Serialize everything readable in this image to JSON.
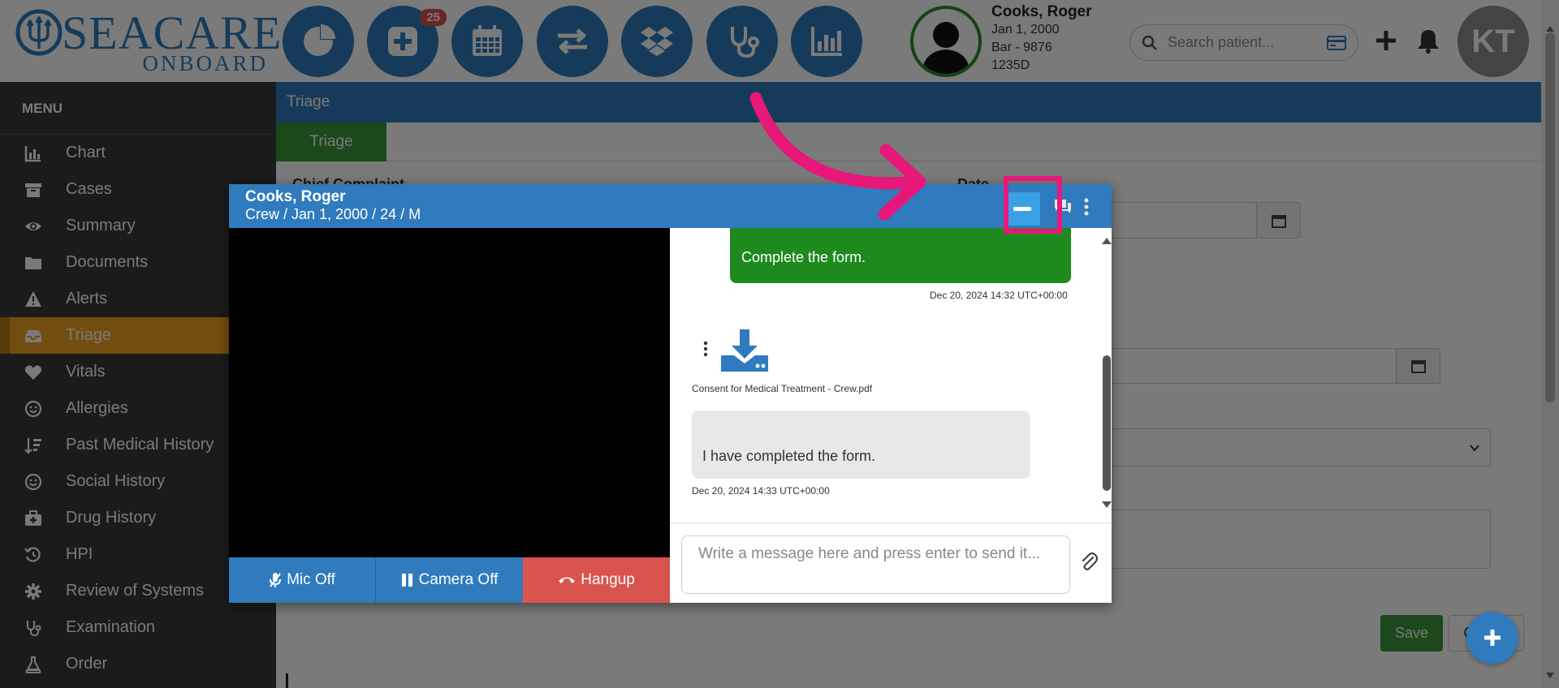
{
  "brand": {
    "name": "SEACARE",
    "tagline": "ONBOARD"
  },
  "nav": {
    "badge_count": "25",
    "buttons": [
      "dashboard-icon",
      "add-case-icon",
      "calendar-icon",
      "transfer-icon",
      "dropbox-icon",
      "stethoscope-icon",
      "analytics-icon"
    ]
  },
  "patient": {
    "name": "Cooks, Roger",
    "dob": "Jan 1, 2000",
    "bar": "Bar - 9876",
    "id": "1235D"
  },
  "search": {
    "placeholder": "Search patient..."
  },
  "user": {
    "initials": "KT"
  },
  "sidebar": {
    "title": "MENU",
    "items": [
      {
        "label": "Chart",
        "icon": "bar-chart-icon"
      },
      {
        "label": "Cases",
        "icon": "archive-icon"
      },
      {
        "label": "Summary",
        "icon": "eye-icon"
      },
      {
        "label": "Documents",
        "icon": "folder-icon"
      },
      {
        "label": "Alerts",
        "icon": "warning-icon"
      },
      {
        "label": "Triage",
        "icon": "inbox-icon",
        "active": true
      },
      {
        "label": "Vitals",
        "icon": "heart-icon"
      },
      {
        "label": "Allergies",
        "icon": "smile-icon"
      },
      {
        "label": "Past Medical History",
        "icon": "sort-icon"
      },
      {
        "label": "Social History",
        "icon": "smile-icon"
      },
      {
        "label": "Drug History",
        "icon": "medkit-icon"
      },
      {
        "label": "HPI",
        "icon": "history-icon"
      },
      {
        "label": "Review of Systems",
        "icon": "gear-icon"
      },
      {
        "label": "Examination",
        "icon": "stethoscope-icon"
      },
      {
        "label": "Order",
        "icon": "flask-icon"
      }
    ]
  },
  "main": {
    "page_title": "Triage",
    "tab": "Triage",
    "chief_complaint_label": "Chief Complaint",
    "date_label": "Date",
    "save_label": "Save",
    "cancel_label": "Cancel"
  },
  "call": {
    "name": "Cooks, Roger",
    "subtitle": "Crew / Jan 1, 2000 / 24 / M",
    "mic_label": "Mic Off",
    "camera_label": "Camera Off",
    "hangup_label": "Hangup",
    "messages": {
      "out_text": "Complete the form.",
      "out_time": "Dec 20, 2024 14:32 UTC+00:00",
      "file_name": "Consent for Medical Treatment - Crew.pdf",
      "in_text": "I have completed the form.",
      "in_time": "Dec 20, 2024 14:33 UTC+00:00"
    },
    "input_placeholder": "Write a message here and press enter to send it..."
  },
  "colors": {
    "primary": "#2f7bbd",
    "active_menu": "#f0a020",
    "success": "#3a9a3a",
    "danger": "#d9534f",
    "highlight": "#e8177a",
    "minimize": "#3aa0e4"
  }
}
